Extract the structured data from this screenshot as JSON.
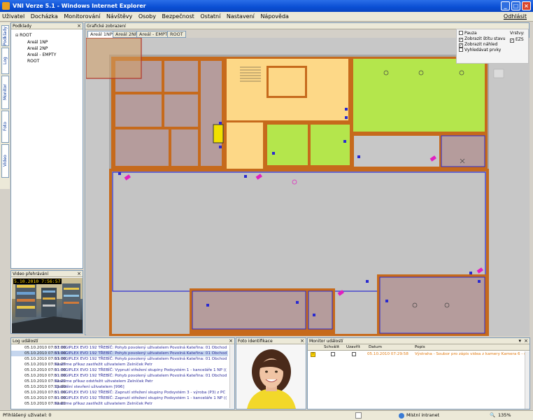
{
  "window": {
    "title": "VNI Verze 5.1 - Windows Internet Explorer"
  },
  "menu": {
    "items": [
      "Uživatel",
      "Docházka",
      "Monitorování",
      "Návštěvy",
      "Osoby",
      "Bezpečnost",
      "Ostatní",
      "Nastavení",
      "Nápověda"
    ],
    "logout": "Odhlásit"
  },
  "left_tabs": [
    "Podklady",
    "Log událostí",
    "Monitor událostí",
    "Foto identifikace",
    "Video přehrávání"
  ],
  "podklady": {
    "title": "Podklady",
    "tree": [
      "ROOT",
      "Areál 1NP",
      "Areál 2NP",
      "Areál - EMPTY",
      "ROOT"
    ]
  },
  "graficke": {
    "title": "Grafické zobrazení",
    "tabs": [
      "Areál 1NP",
      "Areál 2NP",
      "Areál - EMPTY",
      "ROOT"
    ],
    "active_tab": 0,
    "legend": {
      "options": [
        {
          "label": "Pauza",
          "checked": false
        },
        {
          "label": "Zobrazit štítu stavu",
          "checked": true
        },
        {
          "label": "Zobrazit náhled",
          "checked": true
        },
        {
          "label": "Vyhledávat prvky",
          "checked": false
        }
      ],
      "layers_title": "Vrstvy:",
      "layer": {
        "label": "EZS",
        "checked": true
      }
    }
  },
  "video": {
    "title": "Video přehrávání",
    "timestamp": "5.10.2010 7:56:57"
  },
  "log": {
    "title": "Log událostí",
    "rows": [
      {
        "time": "05.10.2010 07:57:00",
        "text": "01 DIGIPLEX EVO 192 TŘEBÍČ: Pohyb povolený uživatelem Povolná Kateřina: 01 Obchod"
      },
      {
        "time": "05.10.2010 07:53:00",
        "text": "01 DIGIPLEX EVO 192 TŘEBÍČ: Pohyb povolený uživatelem Povolná Kateřina: 01 Obchod"
      },
      {
        "time": "05.10.2010 07:53:00",
        "text": "01 DIGIPLEX EVO 192 TŘEBÍČ: Pohyb povolený uživatelem Povolná Kateřina: 01 Obchod"
      },
      {
        "time": "05.10.2010 07:51:27",
        "text": "Realtime příkaz zastřežit uživatelem Zelníček Petr"
      },
      {
        "time": "05.10.2010 07:51:00",
        "text": "01 DIGIPLEX EVO 192 TŘEBÍČ: Vypnutí střežení skupiny Podsystém 1 - kanceláře 1 NP (("
      },
      {
        "time": "05.10.2010 07:51:00",
        "text": "01 DIGIPLEX EVO 192 TŘEBÍČ: Pohyb povolený uživatelem Povolná Kateřina: 01 Obchod"
      },
      {
        "time": "05.10.2010 07:51:22",
        "text": "Realtime příkaz odstřežit uživatelem Zelníček Petr"
      },
      {
        "time": "05.10.2010 07:51:00",
        "text": "Zpoždění stevření uživatelem [996]"
      },
      {
        "time": "05.10.2010 07:51:00",
        "text": "01 DIGIPLEX EVO 192 TŘEBÍČ: Zapnutí střežení skupiny Podsystém 3 - výroba (P3) z PC"
      },
      {
        "time": "05.10.2010 07:51:00",
        "text": "01 DIGIPLEX EVO 192 TŘEBÍČ: Zapnutí střežení skupiny Podsystém 1 - kanceláře 1 NP (("
      },
      {
        "time": "05.10.2010 07:51:12",
        "text": "Realtime příkaz zastřežit uživatelem Zelníček Petr"
      }
    ]
  },
  "foto": {
    "title": "Foto identifikace"
  },
  "monitor": {
    "title": "Monitor událostí",
    "columns": [
      "Schválit",
      "Uzavřít",
      "Datum",
      "Popis"
    ],
    "rows": [
      {
        "date": "05.10.2010 07:29:58",
        "text": "Výstraha - Soubor pro zápis videa z kamery Kamera 6 - chodba"
      }
    ]
  },
  "status": {
    "left": "Přihlášený uživatel:  0",
    "zone": "Místní intranet",
    "zoom": "135%"
  },
  "colors": {
    "titlebar": "#0a4fd4",
    "wall": "#c66a1c",
    "room_brown": "#b59c9c",
    "room_yellow": "#fdd887",
    "room_green": "#b4e64c",
    "floor_gray": "#c4c4c4",
    "sensor_blue": "#2a2ad0",
    "alarm_magenta": "#e21fc0"
  }
}
